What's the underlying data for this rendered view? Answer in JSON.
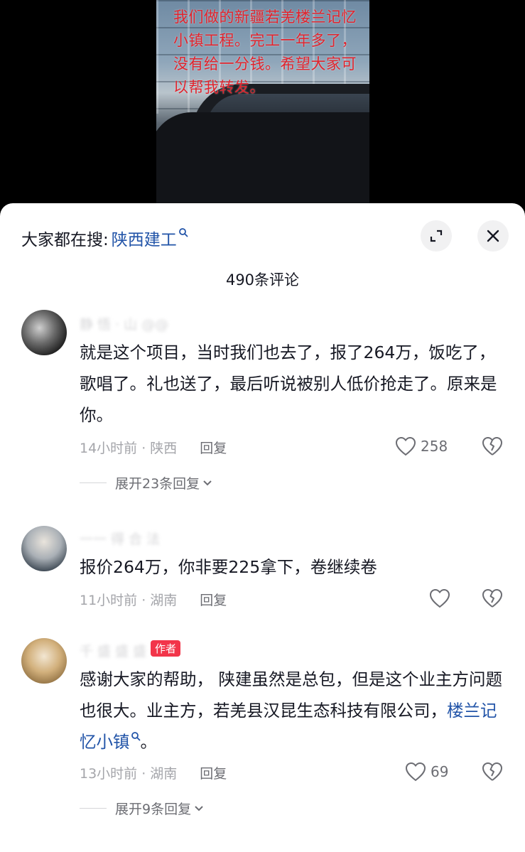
{
  "video": {
    "caption": "我们做的新疆若羌楼兰记忆小镇工程。完工一年多了，没有给一分钱。希望大家可以帮我转发。"
  },
  "sheet": {
    "search_prefix": "大家都在搜:",
    "search_keyword": "陕西建工",
    "comment_count": "490条评论"
  },
  "comments": [
    {
      "nickname": "静 悟 · 山 @@",
      "text": "就是这个项目，当时我们也去了，报了264万，饭吃了，歌唱了。礼也送了，最后听说被别人低价抢走了。原来是你。",
      "time_location": "14小时前 · 陕西",
      "reply_label": "回复",
      "likes": "258",
      "expand_label": "展开23条回复"
    },
    {
      "nickname": "一一 得 合 法",
      "text": "报价264万，你非要225拿下，卷继续卷",
      "time_location": "11小时前 · 湖南",
      "reply_label": "回复",
      "likes": ""
    },
    {
      "nickname": "千 盛 盛 盛",
      "author_badge": "作者",
      "text_before": "感谢大家的帮助， 陕建虽然是总包，但是这个业主方问题也很大。业主方，若羌县汉昆生态科技有限公司，",
      "link_text": "楼兰记忆小镇",
      "text_after": "。",
      "time_location": "13小时前 · 湖南",
      "reply_label": "回复",
      "likes": "69",
      "expand_label": "展开9条回复"
    }
  ],
  "colors": {
    "link": "#2254a8",
    "badge": "#f2354a",
    "caption": "#e1242d"
  }
}
